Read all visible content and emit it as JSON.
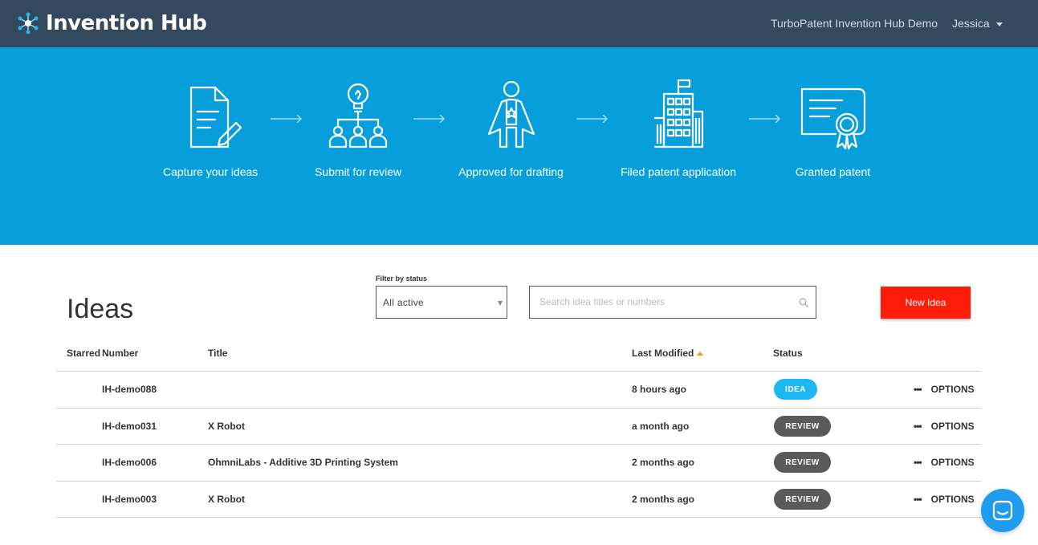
{
  "app": {
    "name": "Invention Hub",
    "org": "TurboPatent Invention Hub Demo",
    "user": "Jessica"
  },
  "hero": {
    "steps": [
      {
        "label": "Capture your ideas",
        "icon": "document-pencil-icon"
      },
      {
        "label": "Submit for review",
        "icon": "lightbulb-team-icon"
      },
      {
        "label": "Approved for drafting",
        "icon": "superhero-icon"
      },
      {
        "label": "Filed patent application",
        "icon": "office-building-icon"
      },
      {
        "label": "Granted patent",
        "icon": "certificate-icon"
      }
    ]
  },
  "ideas": {
    "title": "Ideas",
    "filter": {
      "label": "Filter by status",
      "value": "All active"
    },
    "search_placeholder": "Search idea titles or numbers",
    "new_button": "New Idea",
    "columns": {
      "starred": "Starred",
      "number": "Number",
      "title": "Title",
      "modified": "Last Modified",
      "status": "Status"
    },
    "options_label": "OPTIONS",
    "options_dots": "•••",
    "rows": [
      {
        "number": "IH-demo088",
        "title": "",
        "modified": "8 hours ago",
        "status": "IDEA"
      },
      {
        "number": "IH-demo031",
        "title": "X Robot",
        "modified": "a month ago",
        "status": "REVIEW"
      },
      {
        "number": "IH-demo006",
        "title": "OhmniLabs - Additive 3D Printing System",
        "modified": "2 months ago",
        "status": "REVIEW"
      },
      {
        "number": "IH-demo003",
        "title": "X Robot",
        "modified": "2 months ago",
        "status": "REVIEW"
      }
    ]
  },
  "colors": {
    "header": "#34495e",
    "hero": "#069fdc",
    "new_button": "#ff1c0a",
    "idea_badge": "#1eb8f0",
    "review_badge": "#5a5a5a",
    "chat": "#1f9cf0"
  }
}
